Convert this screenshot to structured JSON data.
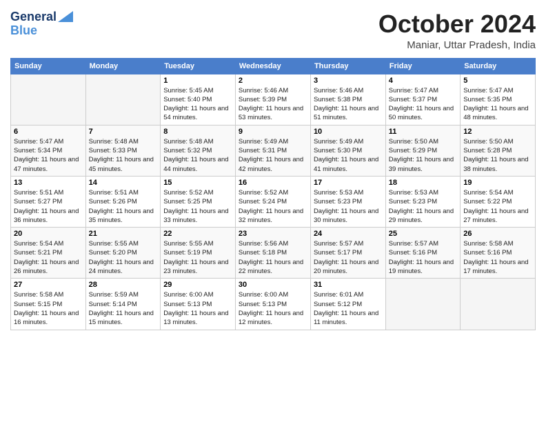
{
  "logo": {
    "line1": "General",
    "line2": "Blue"
  },
  "title": "October 2024",
  "location": "Maniar, Uttar Pradesh, India",
  "headers": [
    "Sunday",
    "Monday",
    "Tuesday",
    "Wednesday",
    "Thursday",
    "Friday",
    "Saturday"
  ],
  "weeks": [
    [
      {
        "day": "",
        "content": ""
      },
      {
        "day": "",
        "content": ""
      },
      {
        "day": "1",
        "content": "Sunrise: 5:45 AM\nSunset: 5:40 PM\nDaylight: 11 hours and 54 minutes."
      },
      {
        "day": "2",
        "content": "Sunrise: 5:46 AM\nSunset: 5:39 PM\nDaylight: 11 hours and 53 minutes."
      },
      {
        "day": "3",
        "content": "Sunrise: 5:46 AM\nSunset: 5:38 PM\nDaylight: 11 hours and 51 minutes."
      },
      {
        "day": "4",
        "content": "Sunrise: 5:47 AM\nSunset: 5:37 PM\nDaylight: 11 hours and 50 minutes."
      },
      {
        "day": "5",
        "content": "Sunrise: 5:47 AM\nSunset: 5:35 PM\nDaylight: 11 hours and 48 minutes."
      }
    ],
    [
      {
        "day": "6",
        "content": "Sunrise: 5:47 AM\nSunset: 5:34 PM\nDaylight: 11 hours and 47 minutes."
      },
      {
        "day": "7",
        "content": "Sunrise: 5:48 AM\nSunset: 5:33 PM\nDaylight: 11 hours and 45 minutes."
      },
      {
        "day": "8",
        "content": "Sunrise: 5:48 AM\nSunset: 5:32 PM\nDaylight: 11 hours and 44 minutes."
      },
      {
        "day": "9",
        "content": "Sunrise: 5:49 AM\nSunset: 5:31 PM\nDaylight: 11 hours and 42 minutes."
      },
      {
        "day": "10",
        "content": "Sunrise: 5:49 AM\nSunset: 5:30 PM\nDaylight: 11 hours and 41 minutes."
      },
      {
        "day": "11",
        "content": "Sunrise: 5:50 AM\nSunset: 5:29 PM\nDaylight: 11 hours and 39 minutes."
      },
      {
        "day": "12",
        "content": "Sunrise: 5:50 AM\nSunset: 5:28 PM\nDaylight: 11 hours and 38 minutes."
      }
    ],
    [
      {
        "day": "13",
        "content": "Sunrise: 5:51 AM\nSunset: 5:27 PM\nDaylight: 11 hours and 36 minutes."
      },
      {
        "day": "14",
        "content": "Sunrise: 5:51 AM\nSunset: 5:26 PM\nDaylight: 11 hours and 35 minutes."
      },
      {
        "day": "15",
        "content": "Sunrise: 5:52 AM\nSunset: 5:25 PM\nDaylight: 11 hours and 33 minutes."
      },
      {
        "day": "16",
        "content": "Sunrise: 5:52 AM\nSunset: 5:24 PM\nDaylight: 11 hours and 32 minutes."
      },
      {
        "day": "17",
        "content": "Sunrise: 5:53 AM\nSunset: 5:23 PM\nDaylight: 11 hours and 30 minutes."
      },
      {
        "day": "18",
        "content": "Sunrise: 5:53 AM\nSunset: 5:23 PM\nDaylight: 11 hours and 29 minutes."
      },
      {
        "day": "19",
        "content": "Sunrise: 5:54 AM\nSunset: 5:22 PM\nDaylight: 11 hours and 27 minutes."
      }
    ],
    [
      {
        "day": "20",
        "content": "Sunrise: 5:54 AM\nSunset: 5:21 PM\nDaylight: 11 hours and 26 minutes."
      },
      {
        "day": "21",
        "content": "Sunrise: 5:55 AM\nSunset: 5:20 PM\nDaylight: 11 hours and 24 minutes."
      },
      {
        "day": "22",
        "content": "Sunrise: 5:55 AM\nSunset: 5:19 PM\nDaylight: 11 hours and 23 minutes."
      },
      {
        "day": "23",
        "content": "Sunrise: 5:56 AM\nSunset: 5:18 PM\nDaylight: 11 hours and 22 minutes."
      },
      {
        "day": "24",
        "content": "Sunrise: 5:57 AM\nSunset: 5:17 PM\nDaylight: 11 hours and 20 minutes."
      },
      {
        "day": "25",
        "content": "Sunrise: 5:57 AM\nSunset: 5:16 PM\nDaylight: 11 hours and 19 minutes."
      },
      {
        "day": "26",
        "content": "Sunrise: 5:58 AM\nSunset: 5:16 PM\nDaylight: 11 hours and 17 minutes."
      }
    ],
    [
      {
        "day": "27",
        "content": "Sunrise: 5:58 AM\nSunset: 5:15 PM\nDaylight: 11 hours and 16 minutes."
      },
      {
        "day": "28",
        "content": "Sunrise: 5:59 AM\nSunset: 5:14 PM\nDaylight: 11 hours and 15 minutes."
      },
      {
        "day": "29",
        "content": "Sunrise: 6:00 AM\nSunset: 5:13 PM\nDaylight: 11 hours and 13 minutes."
      },
      {
        "day": "30",
        "content": "Sunrise: 6:00 AM\nSunset: 5:13 PM\nDaylight: 11 hours and 12 minutes."
      },
      {
        "day": "31",
        "content": "Sunrise: 6:01 AM\nSunset: 5:12 PM\nDaylight: 11 hours and 11 minutes."
      },
      {
        "day": "",
        "content": ""
      },
      {
        "day": "",
        "content": ""
      }
    ]
  ]
}
